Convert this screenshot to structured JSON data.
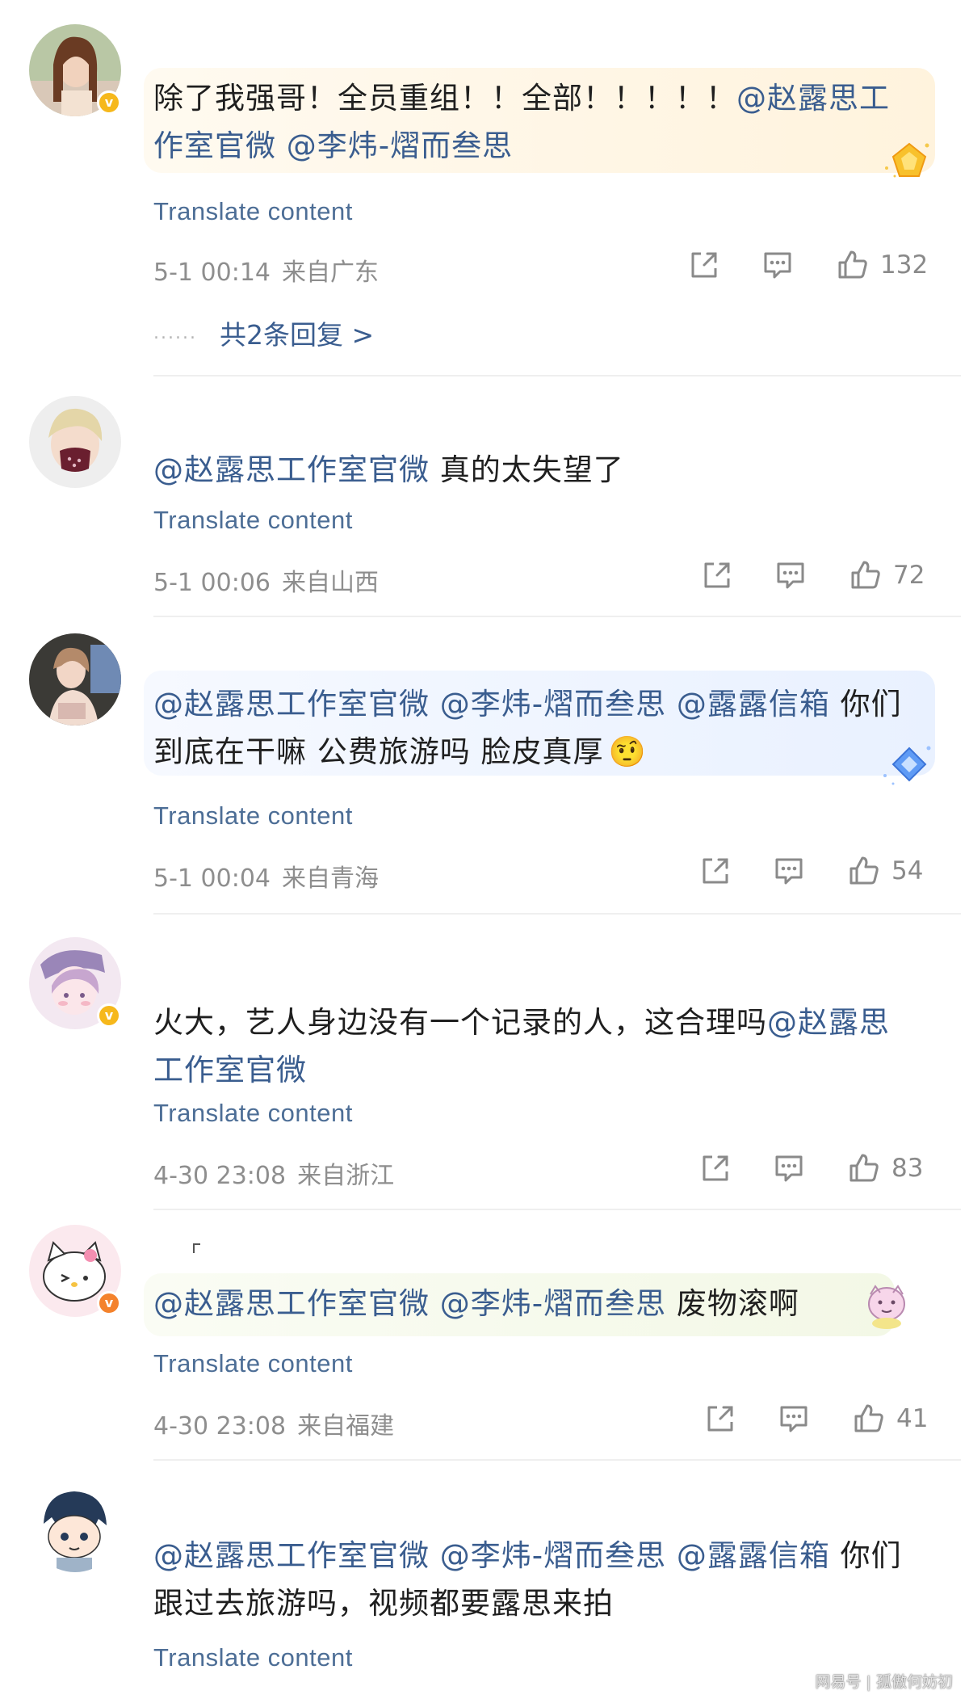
{
  "comments": [
    {
      "segments": [
        {
          "text": "除了我强哥！全员重组！！全部！！！！！",
          "mention": false
        },
        {
          "text": "@赵露思工作室官微",
          "mention": true
        },
        {
          "text": " ",
          "mention": false
        },
        {
          "text": "@李炜-熠而叁思",
          "mention": true
        }
      ],
      "translate": "Translate content",
      "time": "5-1 00:14",
      "location": "来自广东",
      "likes": "132",
      "replies": "共2条回复 >",
      "replies_dots": "......",
      "badge": "gold"
    },
    {
      "segments": [
        {
          "text": "@赵露思工作室官微",
          "mention": true
        },
        {
          "text": " 真的太失望了",
          "mention": false
        }
      ],
      "translate": "Translate content",
      "time": "5-1 00:06",
      "location": "来自山西",
      "likes": "72"
    },
    {
      "segments": [
        {
          "text": "@赵露思工作室官微",
          "mention": true
        },
        {
          "text": " ",
          "mention": false
        },
        {
          "text": "@李炜-熠而叁思",
          "mention": true
        },
        {
          "text": " ",
          "mention": false
        },
        {
          "text": "@露露信箱",
          "mention": true
        },
        {
          "text": " 你们到底在干嘛 公费旅游吗 脸皮真厚",
          "mention": false
        }
      ],
      "emoji": "🤨",
      "translate": "Translate content",
      "time": "5-1 00:04",
      "location": "来自青海",
      "likes": "54"
    },
    {
      "segments": [
        {
          "text": "火大，艺人身边没有一个记录的人，这合理吗",
          "mention": false
        },
        {
          "text": "@赵露思工作室官微",
          "mention": true
        }
      ],
      "translate": "Translate content",
      "time": "4-30 23:08",
      "location": "来自浙江",
      "likes": "83",
      "badge": "gold"
    },
    {
      "segments": [
        {
          "text": "@赵露思工作室官微",
          "mention": true
        },
        {
          "text": " ",
          "mention": false
        },
        {
          "text": "@李炜-熠而叁思",
          "mention": true
        },
        {
          "text": " 废物滚啊",
          "mention": false
        }
      ],
      "translate": "Translate content",
      "time": "4-30 23:08",
      "location": "来自福建",
      "likes": "41",
      "badge": "orange"
    },
    {
      "segments": [
        {
          "text": "@赵露思工作室官微",
          "mention": true
        },
        {
          "text": " ",
          "mention": false
        },
        {
          "text": "@李炜-熠而叁思",
          "mention": true
        },
        {
          "text": " ",
          "mention": false
        },
        {
          "text": "@露露信箱",
          "mention": true
        },
        {
          "text": " 你们跟过去旅游吗，视频都要露思来拍",
          "mention": false
        }
      ],
      "translate": "Translate content"
    }
  ],
  "icons": {
    "share": "share-icon",
    "comment": "comment-icon",
    "like": "thumbs-up-icon",
    "verified": "verified-badge-icon"
  },
  "colors": {
    "mention": "#3a5d8f",
    "translate": "#4d6e96",
    "meta": "#8e8e8e",
    "verified_gold": "#f6b81c",
    "verified_orange": "#f4822c"
  },
  "watermark": "网易号 | 孤傲何妨初"
}
